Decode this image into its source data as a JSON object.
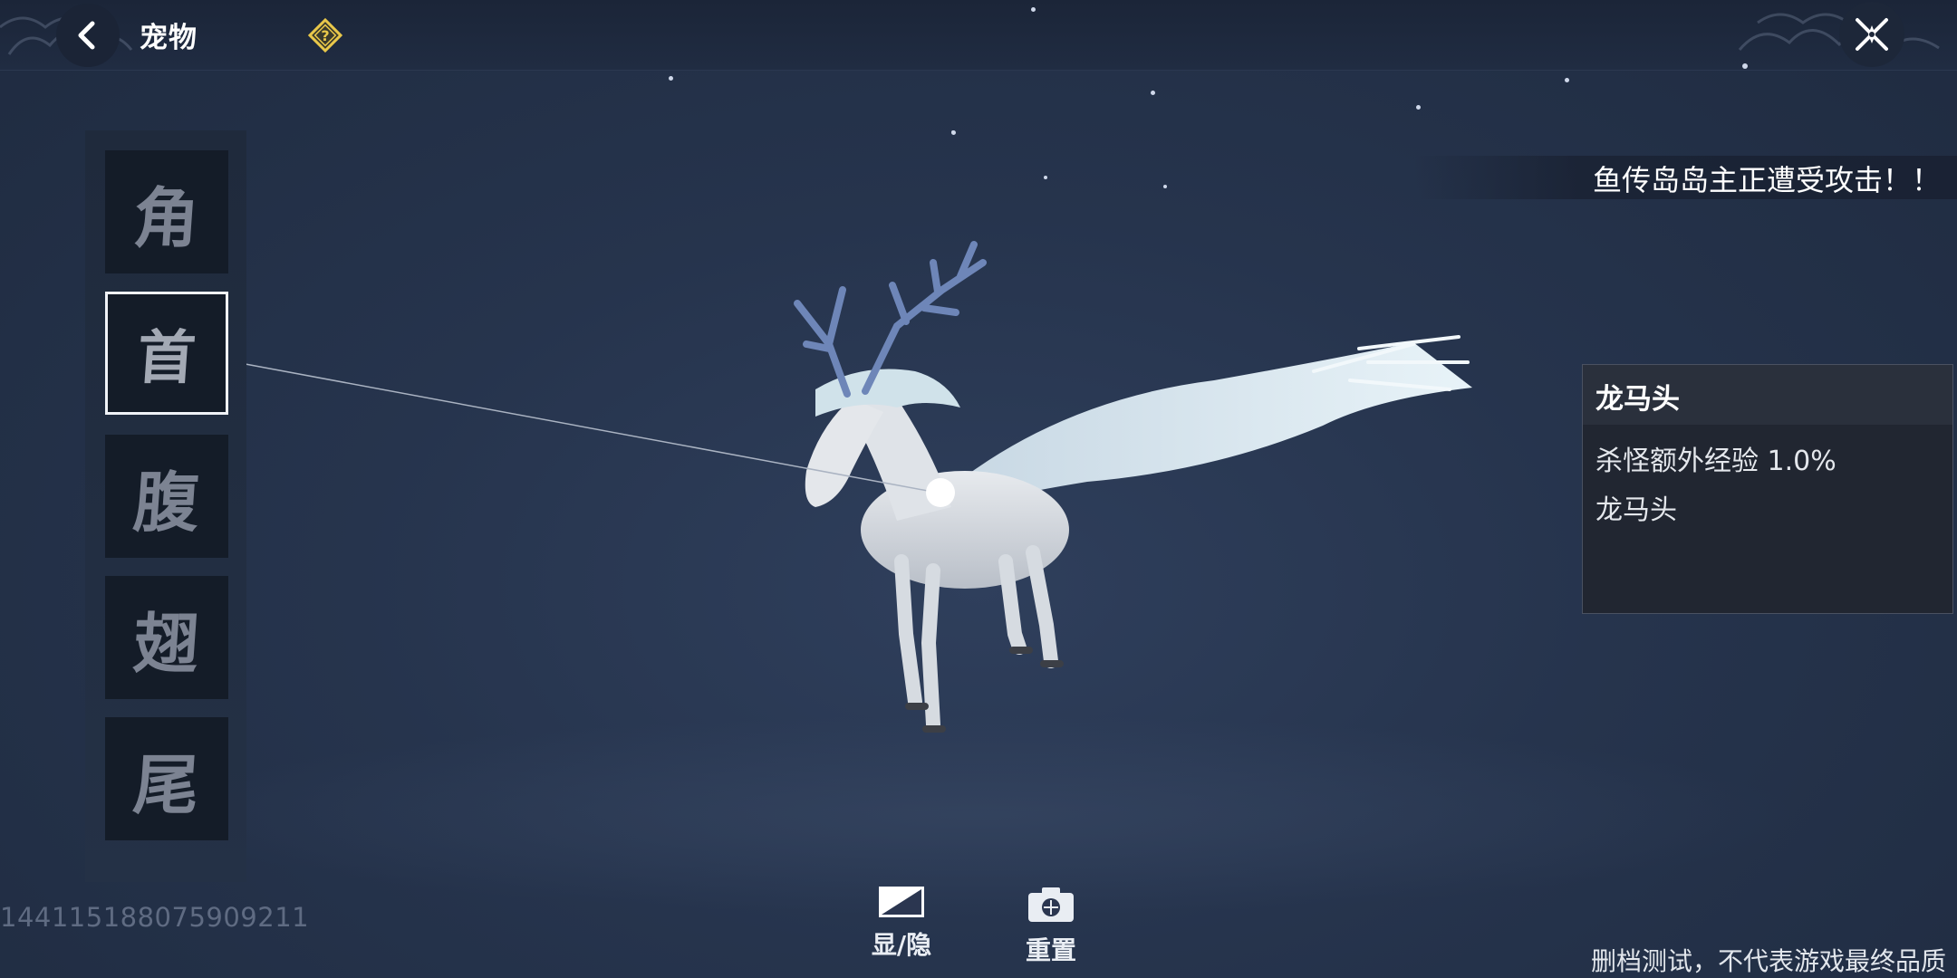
{
  "header": {
    "title": "宠物"
  },
  "notice": {
    "text": "鱼传岛岛主正遭受攻击！！"
  },
  "parts": [
    {
      "label": "角",
      "selected": false
    },
    {
      "label": "首",
      "selected": true
    },
    {
      "label": "腹",
      "selected": false
    },
    {
      "label": "翅",
      "selected": false
    },
    {
      "label": "尾",
      "selected": false
    }
  ],
  "info_panel": {
    "title": "龙马头",
    "lines": [
      "杀怪额外经验 1.0%",
      "龙马头"
    ]
  },
  "pet_id": "1441151880759092​11",
  "bottom_controls": {
    "toggle_label": "显/隐",
    "reset_label": "重置"
  },
  "disclaimer": "删档测试，不代表游戏最终品质"
}
